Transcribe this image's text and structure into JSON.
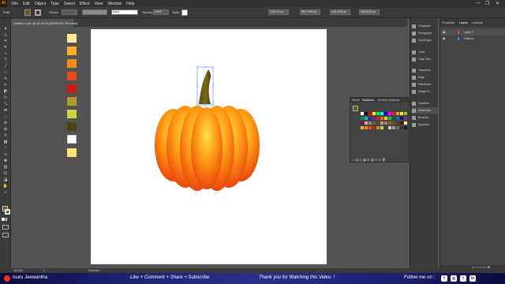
{
  "menubar": {
    "logo": "Ai",
    "items": [
      "File",
      "Edit",
      "Object",
      "Type",
      "Select",
      "Effect",
      "View",
      "Window",
      "Help"
    ],
    "win_controls": [
      "—",
      "❐",
      "✕"
    ]
  },
  "controlbar": {
    "path_label": "Path",
    "stroke_label": "Stroke:",
    "stroke_style": "Basic",
    "opacity_label": "Opacity:",
    "opacity_value": "100%",
    "style_label": "Style:",
    "x_value": "1211.31 px",
    "y_value": "567.1909 px",
    "w_value": "108.1205 px",
    "h_value": "168.8244 px"
  },
  "document": {
    "tab_title": "Untitled-1.ai* @ 16.19 % (RGB/CPU Preview)"
  },
  "color_chips": [
    "#ffe79a",
    "#f7b21d",
    "#f48a1a",
    "#ea4a14",
    "#c91e11",
    "#b09a2c",
    "#d0d34a",
    "#4a4513",
    "#ffffff",
    "#ffe37a"
  ],
  "pumpkin": {
    "stem_color": "#6b5a14",
    "rib_light": "#ffd53a",
    "rib_mid": "#ff8a10",
    "rib_dark": "#e8400e"
  },
  "swatches_panel": {
    "tabs": [
      "Stroke",
      "Swatches",
      "Brushes",
      "Symbols"
    ],
    "active_tab": "Swatches"
  },
  "right_dock": {
    "items": [
      "Character",
      "Paragraph",
      "OpenType",
      "Color",
      "Color Gui...",
      "Transform",
      "Align",
      "Pathfinder",
      "Image Tr...",
      "Gradient",
      "Swatches",
      "Brushes",
      "Symbols"
    ],
    "active_item": "Swatches"
  },
  "layers_panel": {
    "tabs": [
      "Properties",
      "Layers",
      "Libraries"
    ],
    "active_tab": "Layers",
    "layers": [
      {
        "name": "Layer 2",
        "color": "#ff3a3a"
      },
      {
        "name": "Colours",
        "color": "#3a8aff"
      }
    ]
  },
  "statusbar": {
    "zoom": "16.19%",
    "page": "1",
    "tool": "Selection"
  },
  "footer": {
    "author": "Isuru Jeewantha",
    "cta": "Like + Comment + Share + Subscribe",
    "thanks": "Thank you for Watching this Video. !",
    "follow": "Follow me on :",
    "socials": [
      "f",
      "◎",
      "t",
      "in"
    ]
  }
}
